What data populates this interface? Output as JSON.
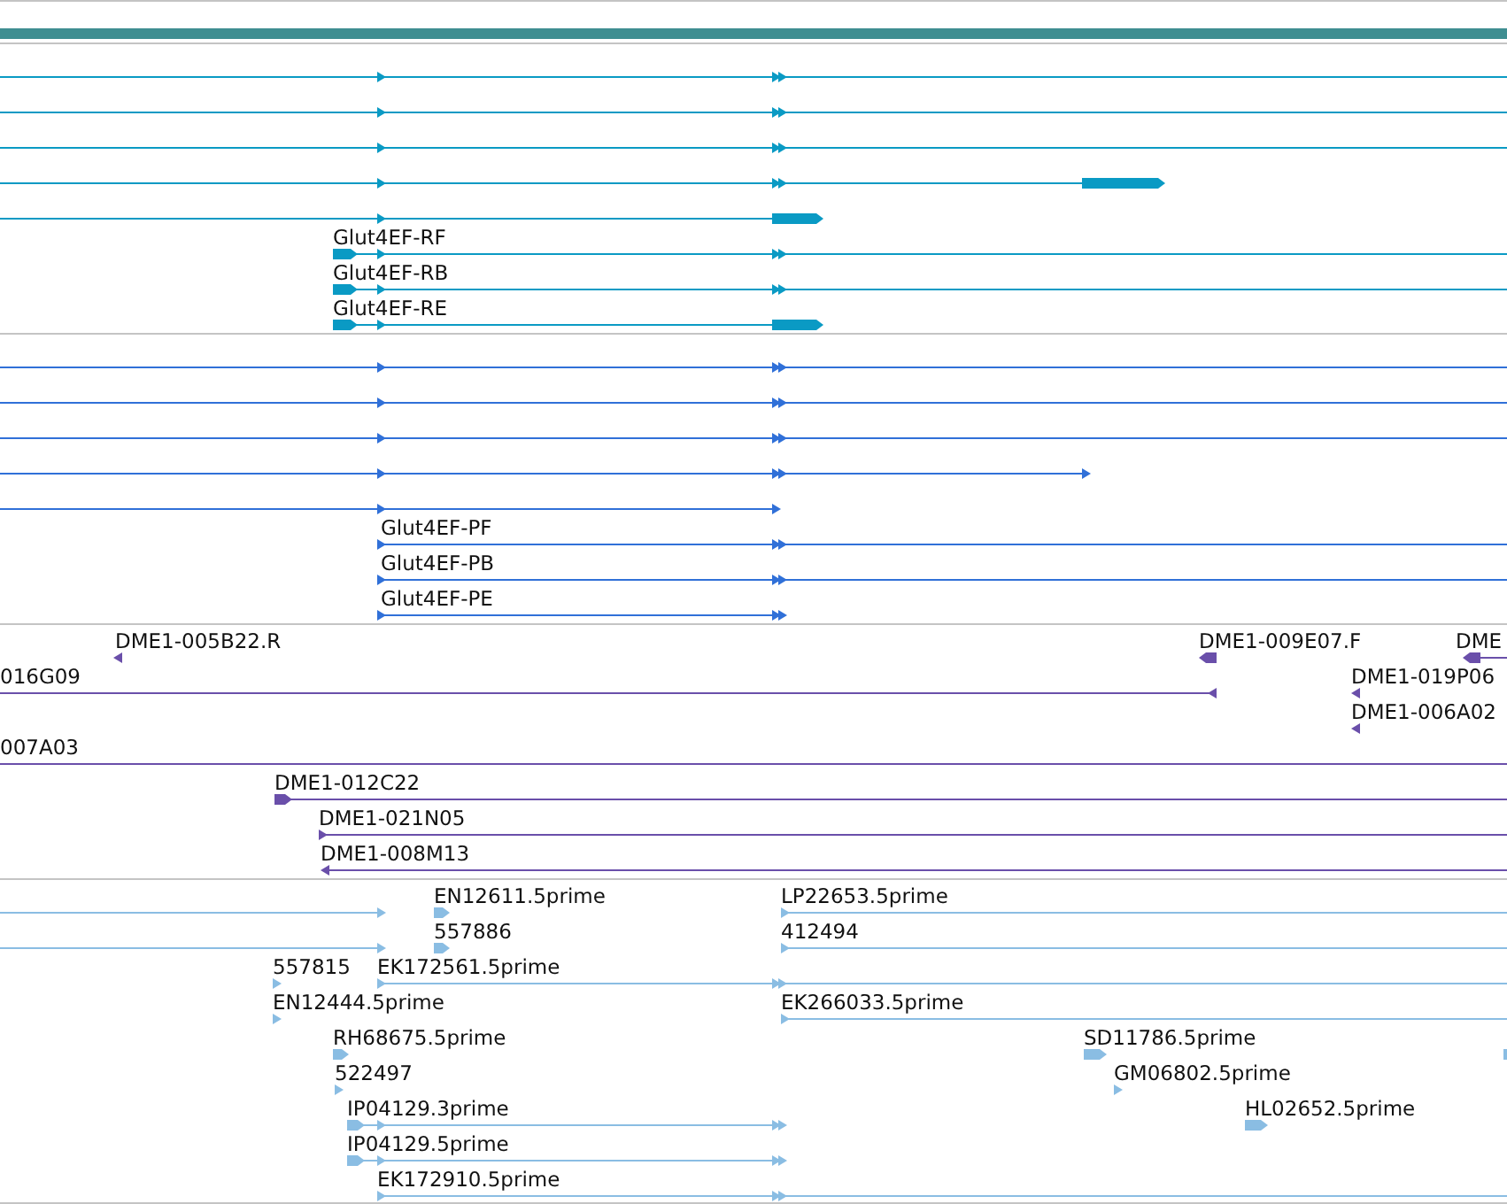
{
  "tracks": [
    {
      "color": "#0a9ac4",
      "features": [
        {
          "kind": "forward"
        },
        {
          "kind": "forward"
        },
        {
          "kind": "forward"
        },
        {
          "kind": "forward"
        },
        {
          "kind": "forward"
        },
        {
          "label": "Glut4EF-RF",
          "kind": "forward"
        },
        {
          "label": "Glut4EF-RB",
          "kind": "forward"
        },
        {
          "label": "Glut4EF-RE",
          "kind": "forward"
        }
      ]
    },
    {
      "color": "#3070d8",
      "features": [
        {
          "kind": "forward"
        },
        {
          "kind": "forward"
        },
        {
          "kind": "forward"
        },
        {
          "kind": "forward"
        },
        {
          "kind": "forward"
        },
        {
          "label": "Glut4EF-PF",
          "kind": "forward"
        },
        {
          "label": "Glut4EF-PB",
          "kind": "forward"
        },
        {
          "label": "Glut4EF-PE",
          "kind": "forward"
        }
      ]
    },
    {
      "color": "#6a4faa",
      "features": [
        {
          "label": "DME1-005B22.R",
          "kind": "reverse"
        },
        {
          "label": "DME1-009E07.F",
          "kind": "reverse"
        },
        {
          "label": "DME",
          "kind": "reverse"
        },
        {
          "label": "016G09",
          "kind": "reverse"
        },
        {
          "label": "DME1-019P06",
          "kind": "reverse"
        },
        {
          "label": "DME1-006A02",
          "kind": "reverse"
        },
        {
          "label": "007A03",
          "kind": "plain"
        },
        {
          "label": "DME1-012C22",
          "kind": "forward"
        },
        {
          "label": "DME1-021N05",
          "kind": "forward"
        },
        {
          "label": "DME1-008M13",
          "kind": "reverse"
        }
      ]
    },
    {
      "color": "#8abde3",
      "features": [
        {
          "kind": "forward"
        },
        {
          "label": "EN12611.5prime",
          "kind": "forward"
        },
        {
          "label": "LP22653.5prime",
          "kind": "forward"
        },
        {
          "kind": "forward"
        },
        {
          "label": "557886",
          "kind": "forward"
        },
        {
          "label": "412494",
          "kind": "forward"
        },
        {
          "label": "557815",
          "kind": "forward"
        },
        {
          "label": "EK172561.5prime",
          "kind": "forward"
        },
        {
          "label": "EN12444.5prime",
          "kind": "forward"
        },
        {
          "label": "EK266033.5prime",
          "kind": "forward"
        },
        {
          "label": "RH68675.5prime",
          "kind": "forward"
        },
        {
          "label": "SD11786.5prime",
          "kind": "forward"
        },
        {
          "kind": "plain"
        },
        {
          "label": "522497",
          "kind": "forward"
        },
        {
          "label": "GM06802.5prime",
          "kind": "forward"
        },
        {
          "label": "IP04129.3prime",
          "kind": "forward"
        },
        {
          "label": "HL02652.5prime",
          "kind": "forward"
        },
        {
          "label": "IP04129.5prime",
          "kind": "forward"
        },
        {
          "label": "EK172910.5prime",
          "kind": "forward"
        }
      ]
    }
  ]
}
